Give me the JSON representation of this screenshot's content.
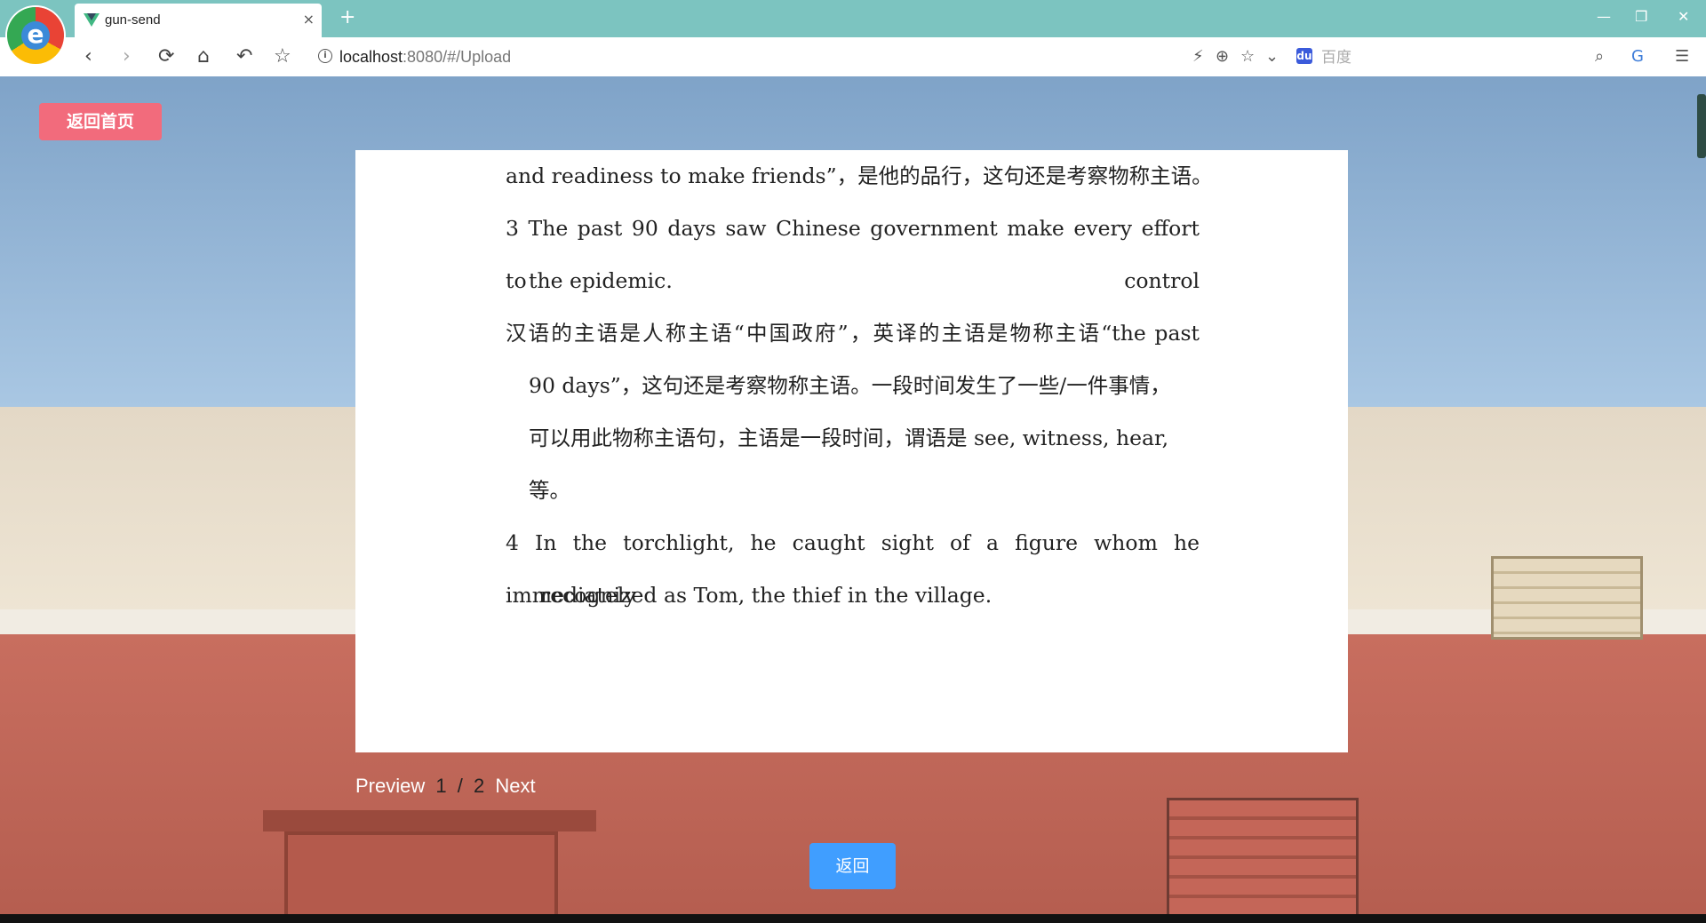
{
  "browser": {
    "tab_title": "gun-send",
    "tab_close": "×",
    "new_tab": "+",
    "window_controls": {
      "minimize": "—",
      "restore": "❐",
      "close": "✕"
    },
    "nav": {
      "back": "‹",
      "forward": "›",
      "reload": "⟳",
      "home": "⌂",
      "undo": "↶",
      "bookmark": "☆"
    },
    "url_host": "localhost",
    "url_path": ":8080/#/Upload",
    "search_placeholder": "百度",
    "logo_letter": "e"
  },
  "page": {
    "back_home_label": "返回首页",
    "return_label": "返回",
    "pager": {
      "prev": "Preview",
      "current": "1",
      "sep": "/",
      "total": "2",
      "next": "Next"
    },
    "doc_lines": [
      "and readiness to make friends”，是他的品行，这句还是考察物称主语。",
      "3 The past 90 days saw Chinese government make every effort to control",
      "the epidemic.",
      "汉语的主语是人称主语“中国政府”，英译的主语是物称主语“the past",
      "90 days”，这句还是考察物称主语。一段时间发生了一些/一件事情，",
      "可以用此物称主语句，主语是一段时间，谓语是 see, witness, hear,",
      "等。",
      "4 In the torchlight, he caught sight of a figure whom he immediately",
      "recognized as Tom, the thief in the village."
    ]
  },
  "colors": {
    "titlebar": "#7cc4c0",
    "back_home_button": "#f26b7c",
    "return_button": "#409eff"
  }
}
